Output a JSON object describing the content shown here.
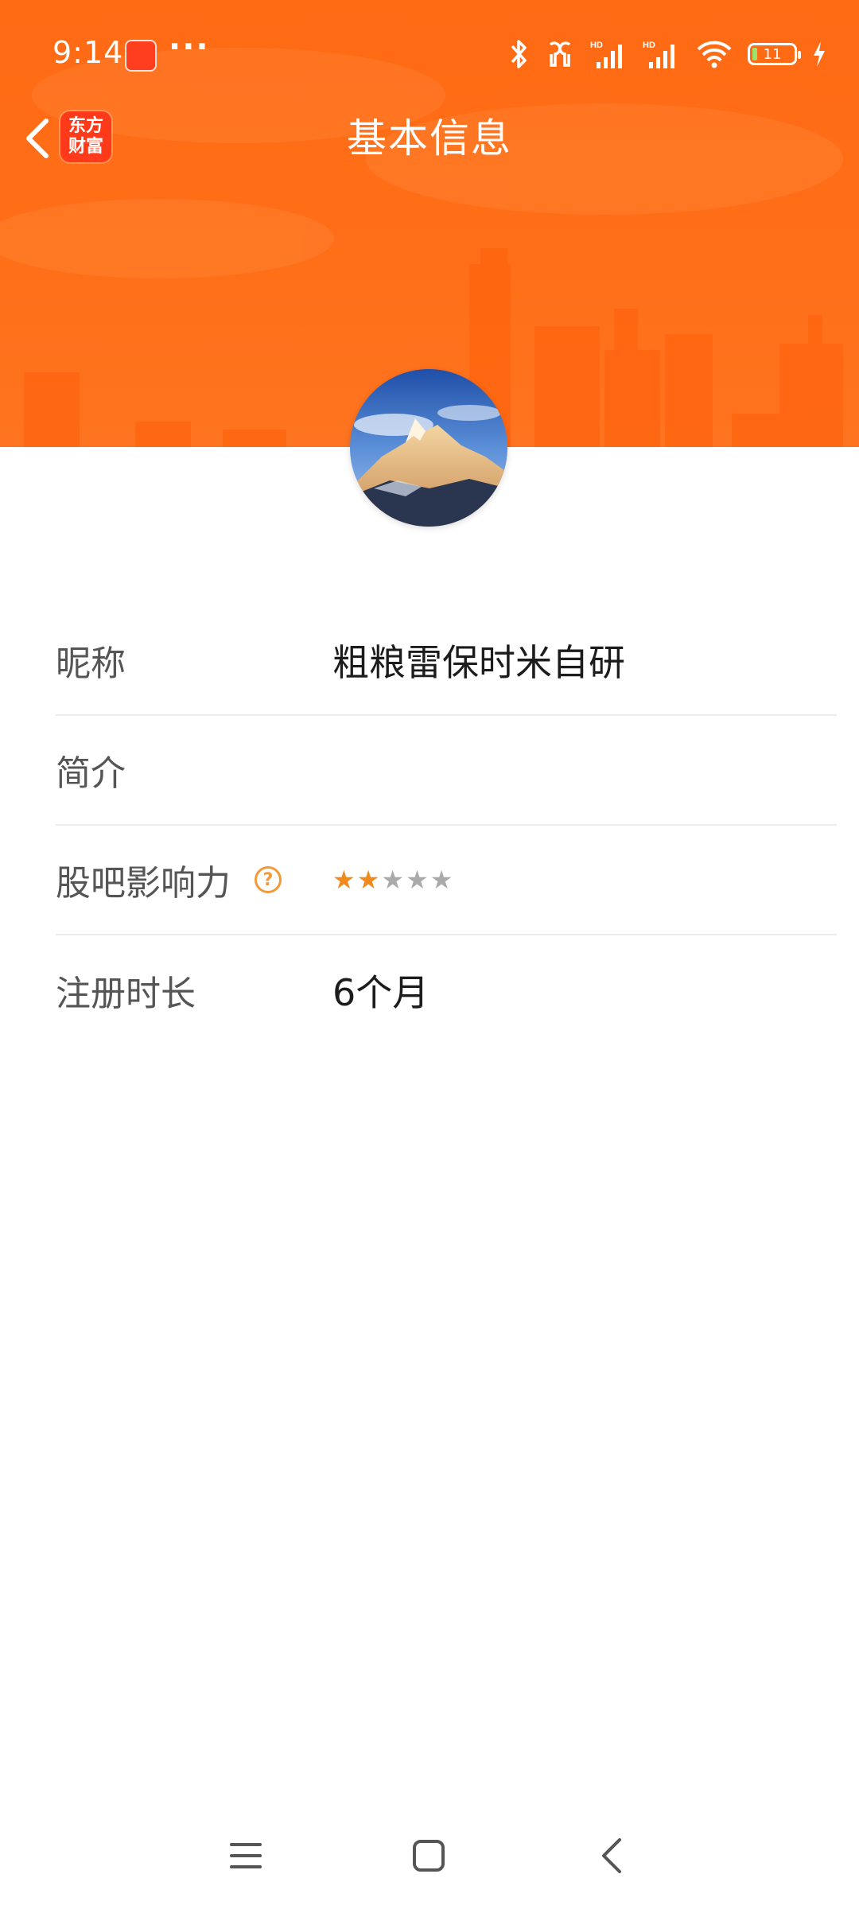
{
  "status_bar": {
    "time": "9:14",
    "more": "···",
    "battery_level": "11"
  },
  "nav": {
    "title": "基本信息",
    "app_logo_line1": "东方",
    "app_logo_line2": "财富"
  },
  "profile": {
    "rows": [
      {
        "label": "昵称",
        "value": "粗粮雷保时米自研"
      },
      {
        "label": "简介",
        "value": ""
      },
      {
        "label": "股吧影响力",
        "help": "?",
        "rating": 2,
        "rating_max": 5
      },
      {
        "label": "注册时长",
        "value": "6个月"
      }
    ]
  },
  "colors": {
    "accent": "#ff6a13",
    "star_on": "#f08a1c",
    "star_off": "#aaaaaa"
  },
  "icons": {
    "back": "chevron-left-icon",
    "help": "question-circle-icon",
    "nav_menu": "menu-icon",
    "nav_home": "square-home-icon",
    "nav_back": "triangle-back-icon"
  }
}
